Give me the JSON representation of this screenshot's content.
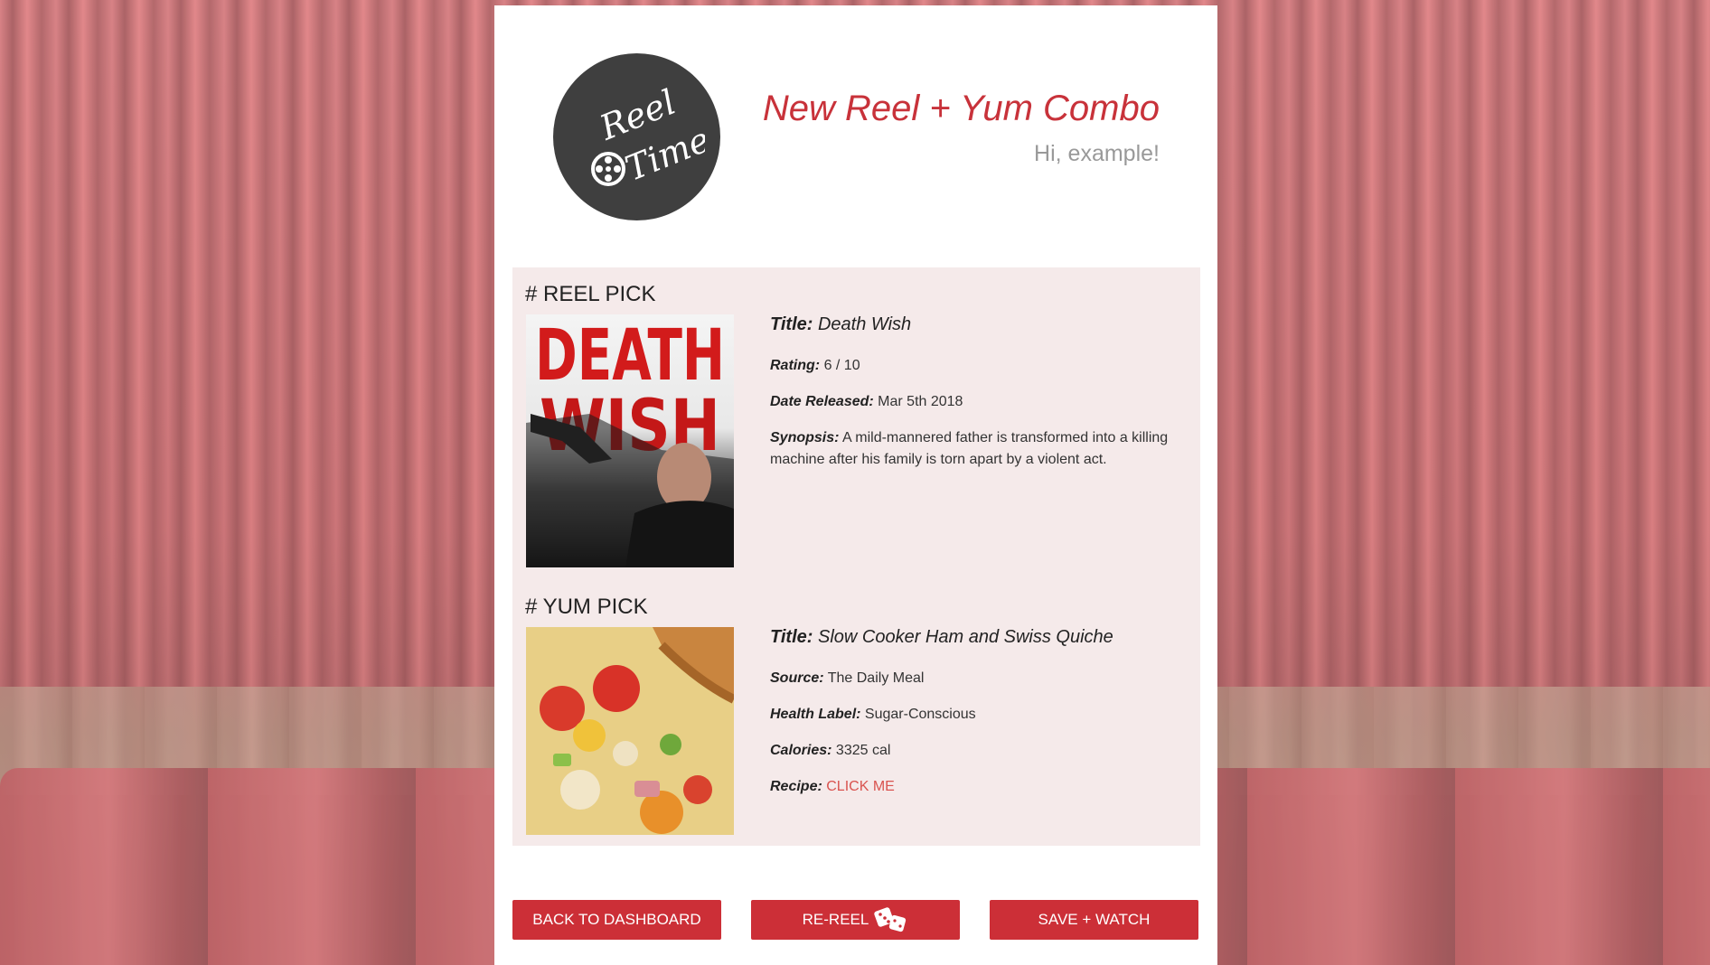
{
  "app": {
    "logo_text": "Reel Time",
    "page_title": "New Reel + Yum Combo",
    "greeting": "Hi, example!"
  },
  "reel": {
    "heading": "# REEL PICK",
    "poster_text": [
      "DEATH",
      "WISH"
    ],
    "title_label": "Title:",
    "title": "Death Wish",
    "rating_label": "Rating:",
    "rating": "6 / 10",
    "released_label": "Date Released:",
    "released": "Mar 5th 2018",
    "synopsis_label": "Synopsis:",
    "synopsis": "A mild-mannered father is transformed into a killing machine after his family is torn apart by a violent act."
  },
  "yum": {
    "heading": "# YUM PICK",
    "title_label": "Title:",
    "title": "Slow Cooker Ham and Swiss Quiche",
    "source_label": "Source:",
    "source": "The Daily Meal",
    "health_label": "Health Label:",
    "health": "Sugar-Conscious",
    "calories_label": "Calories:",
    "calories": "3325 cal",
    "recipe_label": "Recipe:",
    "recipe_link": "CLICK ME"
  },
  "actions": {
    "back": "BACK TO DASHBOARD",
    "rereel": "RE-REEL",
    "save": "SAVE + WATCH"
  },
  "colors": {
    "accent": "#cc2f37",
    "title_red": "#c8323a",
    "pick_bg": "#f5eaea",
    "link": "#d9534f"
  }
}
